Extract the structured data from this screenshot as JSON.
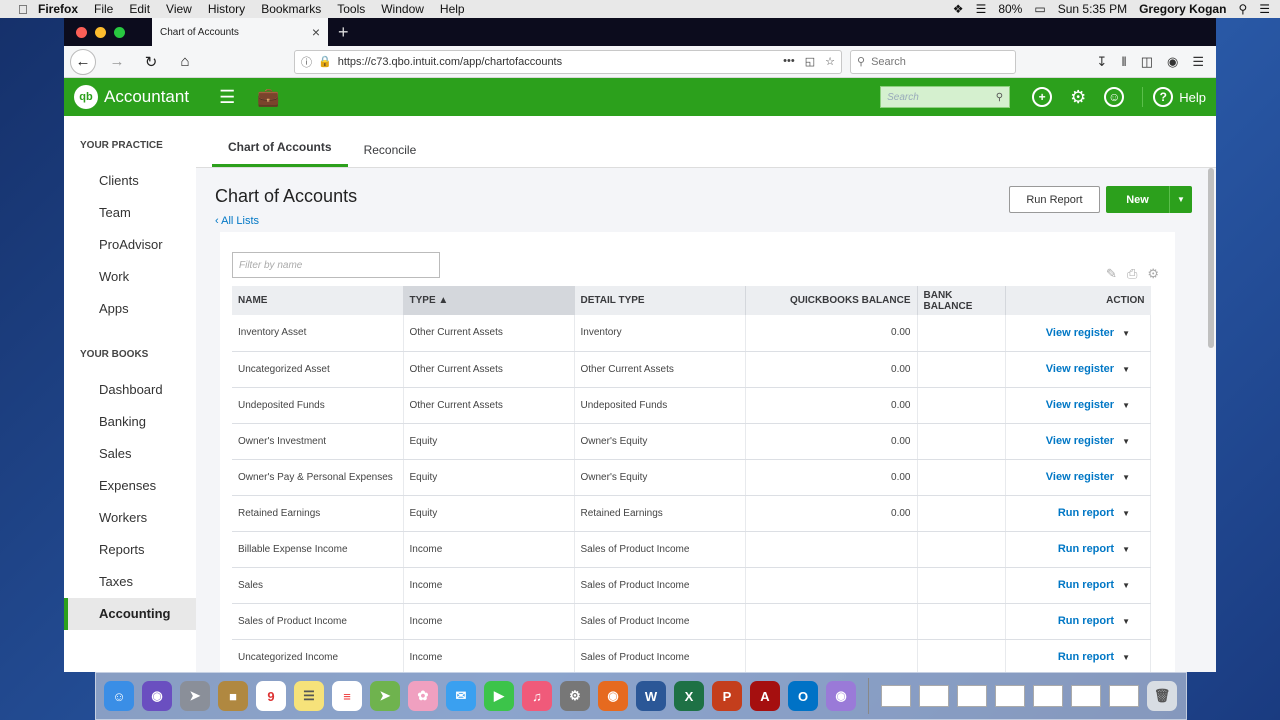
{
  "menubar": {
    "items": [
      "Firefox",
      "File",
      "Edit",
      "View",
      "History",
      "Bookmarks",
      "Tools",
      "Window",
      "Help"
    ],
    "battery": "80%",
    "clock": "Sun 5:35 PM",
    "user": "Gregory Kogan"
  },
  "browser": {
    "tab_title": "Chart of Accounts",
    "url": "https://c73.qbo.intuit.com/app/chartofaccounts",
    "search_placeholder": "Search"
  },
  "qbo": {
    "brand": "Accountant",
    "logo_text": "qb",
    "search_placeholder": "Search",
    "help": "Help"
  },
  "sidebar": {
    "section_practice": "YOUR PRACTICE",
    "practice_items": [
      "Clients",
      "Team",
      "ProAdvisor",
      "Work",
      "Apps"
    ],
    "section_books": "YOUR BOOKS",
    "books_items": [
      "Dashboard",
      "Banking",
      "Sales",
      "Expenses",
      "Workers",
      "Reports",
      "Taxes",
      "Accounting"
    ],
    "active": "Accounting"
  },
  "page": {
    "tabs": [
      "Chart of Accounts",
      "Reconcile"
    ],
    "title": "Chart of Accounts",
    "all_lists": "All Lists",
    "run_report": "Run Report",
    "new": "New",
    "filter_placeholder": "Filter by name"
  },
  "table": {
    "headers": [
      "NAME",
      "TYPE",
      "DETAIL TYPE",
      "QUICKBOOKS BALANCE",
      "BANK BALANCE",
      "ACTION"
    ],
    "rows": [
      {
        "name": "Inventory Asset",
        "type": "Other Current Assets",
        "detail": "Inventory",
        "qb_balance": "0.00",
        "bank_balance": "",
        "action": "View register"
      },
      {
        "name": "Uncategorized Asset",
        "type": "Other Current Assets",
        "detail": "Other Current Assets",
        "qb_balance": "0.00",
        "bank_balance": "",
        "action": "View register"
      },
      {
        "name": "Undeposited Funds",
        "type": "Other Current Assets",
        "detail": "Undeposited Funds",
        "qb_balance": "0.00",
        "bank_balance": "",
        "action": "View register"
      },
      {
        "name": "Owner's Investment",
        "type": "Equity",
        "detail": "Owner's Equity",
        "qb_balance": "0.00",
        "bank_balance": "",
        "action": "View register"
      },
      {
        "name": "Owner's Pay & Personal Expenses",
        "type": "Equity",
        "detail": "Owner's Equity",
        "qb_balance": "0.00",
        "bank_balance": "",
        "action": "View register"
      },
      {
        "name": "Retained Earnings",
        "type": "Equity",
        "detail": "Retained Earnings",
        "qb_balance": "0.00",
        "bank_balance": "",
        "action": "Run report"
      },
      {
        "name": "Billable Expense Income",
        "type": "Income",
        "detail": "Sales of Product Income",
        "qb_balance": "",
        "bank_balance": "",
        "action": "Run report"
      },
      {
        "name": "Sales",
        "type": "Income",
        "detail": "Sales of Product Income",
        "qb_balance": "",
        "bank_balance": "",
        "action": "Run report"
      },
      {
        "name": "Sales of Product Income",
        "type": "Income",
        "detail": "Sales of Product Income",
        "qb_balance": "",
        "bank_balance": "",
        "action": "Run report"
      },
      {
        "name": "Uncategorized Income",
        "type": "Income",
        "detail": "Sales of Product Income",
        "qb_balance": "",
        "bank_balance": "",
        "action": "Run report"
      }
    ]
  },
  "colors": {
    "accent": "#2ca01c",
    "link": "#0077c5"
  }
}
